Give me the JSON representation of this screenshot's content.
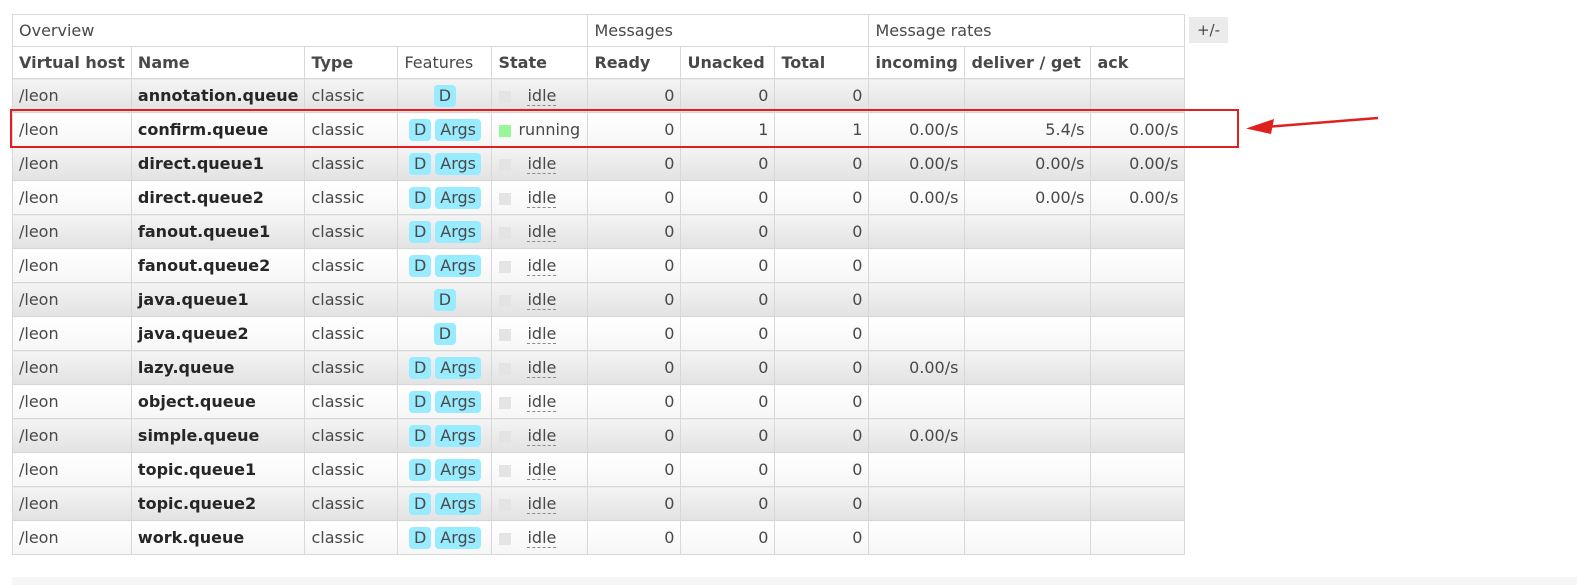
{
  "toggle_label": "+/-",
  "groups": [
    {
      "label": "Overview",
      "span": 5
    },
    {
      "label": "Messages",
      "span": 3
    },
    {
      "label": "Message rates",
      "span": 3
    }
  ],
  "columns": [
    "Virtual host",
    "Name",
    "Type",
    "Features",
    "State",
    "Ready",
    "Unacked",
    "Total",
    "incoming",
    "deliver / get",
    "ack"
  ],
  "feature_labels": {
    "durable": "D",
    "args": "Args"
  },
  "queues": [
    {
      "vhost": "/leon",
      "name": "annotation.queue",
      "type": "classic",
      "features": [
        "D"
      ],
      "state": "idle",
      "ready": "0",
      "unacked": "0",
      "total": "0",
      "incoming": "",
      "deliver_get": "",
      "ack": ""
    },
    {
      "vhost": "/leon",
      "name": "confirm.queue",
      "type": "classic",
      "features": [
        "D",
        "Args"
      ],
      "state": "running",
      "ready": "0",
      "unacked": "1",
      "total": "1",
      "incoming": "0.00/s",
      "deliver_get": "5.4/s",
      "ack": "0.00/s"
    },
    {
      "vhost": "/leon",
      "name": "direct.queue1",
      "type": "classic",
      "features": [
        "D",
        "Args"
      ],
      "state": "idle",
      "ready": "0",
      "unacked": "0",
      "total": "0",
      "incoming": "0.00/s",
      "deliver_get": "0.00/s",
      "ack": "0.00/s"
    },
    {
      "vhost": "/leon",
      "name": "direct.queue2",
      "type": "classic",
      "features": [
        "D",
        "Args"
      ],
      "state": "idle",
      "ready": "0",
      "unacked": "0",
      "total": "0",
      "incoming": "0.00/s",
      "deliver_get": "0.00/s",
      "ack": "0.00/s"
    },
    {
      "vhost": "/leon",
      "name": "fanout.queue1",
      "type": "classic",
      "features": [
        "D",
        "Args"
      ],
      "state": "idle",
      "ready": "0",
      "unacked": "0",
      "total": "0",
      "incoming": "",
      "deliver_get": "",
      "ack": ""
    },
    {
      "vhost": "/leon",
      "name": "fanout.queue2",
      "type": "classic",
      "features": [
        "D",
        "Args"
      ],
      "state": "idle",
      "ready": "0",
      "unacked": "0",
      "total": "0",
      "incoming": "",
      "deliver_get": "",
      "ack": ""
    },
    {
      "vhost": "/leon",
      "name": "java.queue1",
      "type": "classic",
      "features": [
        "D"
      ],
      "state": "idle",
      "ready": "0",
      "unacked": "0",
      "total": "0",
      "incoming": "",
      "deliver_get": "",
      "ack": ""
    },
    {
      "vhost": "/leon",
      "name": "java.queue2",
      "type": "classic",
      "features": [
        "D"
      ],
      "state": "idle",
      "ready": "0",
      "unacked": "0",
      "total": "0",
      "incoming": "",
      "deliver_get": "",
      "ack": ""
    },
    {
      "vhost": "/leon",
      "name": "lazy.queue",
      "type": "classic",
      "features": [
        "D",
        "Args"
      ],
      "state": "idle",
      "ready": "0",
      "unacked": "0",
      "total": "0",
      "incoming": "0.00/s",
      "deliver_get": "",
      "ack": ""
    },
    {
      "vhost": "/leon",
      "name": "object.queue",
      "type": "classic",
      "features": [
        "D",
        "Args"
      ],
      "state": "idle",
      "ready": "0",
      "unacked": "0",
      "total": "0",
      "incoming": "",
      "deliver_get": "",
      "ack": ""
    },
    {
      "vhost": "/leon",
      "name": "simple.queue",
      "type": "classic",
      "features": [
        "D",
        "Args"
      ],
      "state": "idle",
      "ready": "0",
      "unacked": "0",
      "total": "0",
      "incoming": "0.00/s",
      "deliver_get": "",
      "ack": ""
    },
    {
      "vhost": "/leon",
      "name": "topic.queue1",
      "type": "classic",
      "features": [
        "D",
        "Args"
      ],
      "state": "idle",
      "ready": "0",
      "unacked": "0",
      "total": "0",
      "incoming": "",
      "deliver_get": "",
      "ack": ""
    },
    {
      "vhost": "/leon",
      "name": "topic.queue2",
      "type": "classic",
      "features": [
        "D",
        "Args"
      ],
      "state": "idle",
      "ready": "0",
      "unacked": "0",
      "total": "0",
      "incoming": "",
      "deliver_get": "",
      "ack": ""
    },
    {
      "vhost": "/leon",
      "name": "work.queue",
      "type": "classic",
      "features": [
        "D",
        "Args"
      ],
      "state": "idle",
      "ready": "0",
      "unacked": "0",
      "total": "0",
      "incoming": "",
      "deliver_get": "",
      "ack": ""
    }
  ],
  "annotation": {
    "color": "#e0201f",
    "highlighted_queue": "confirm.queue"
  },
  "colors": {
    "feature_badge": "#99ebff",
    "running_state": "#98f898",
    "idle_state": "#e4e4e4"
  }
}
